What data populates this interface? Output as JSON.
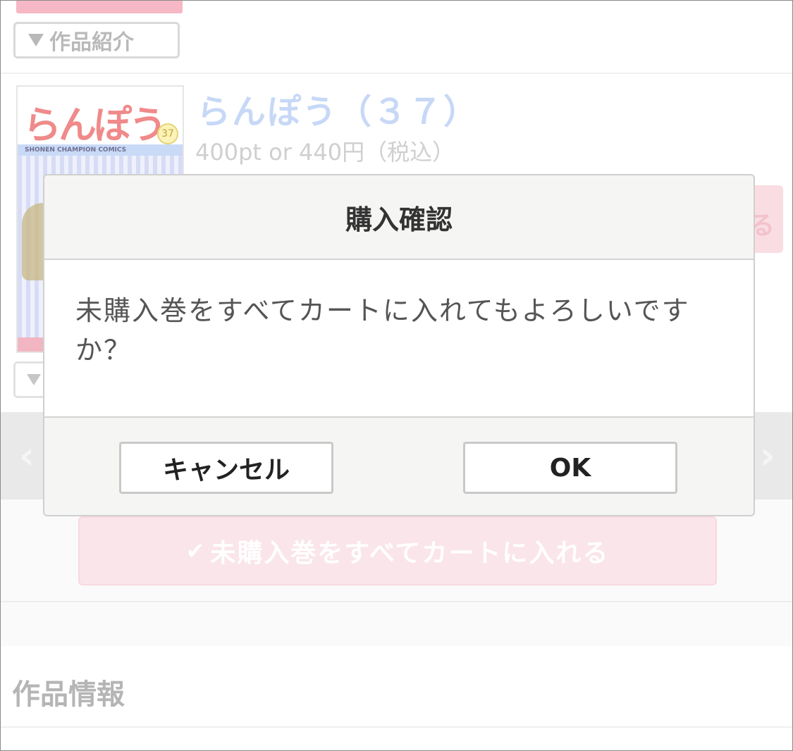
{
  "background": {
    "intro_label": "作品紹介",
    "volume_title": "らんぽう（３７）",
    "volume_price": "400pt or 440円（税込）",
    "cover": {
      "title": "らんぽう",
      "volume_badge": "37",
      "band_text": "SHONEN CHAMPION COMICS"
    },
    "cart_partial": "る",
    "pager": {
      "prev": "‹",
      "next": "›"
    },
    "bulk_button": {
      "check": "✔",
      "label": "未購入巻をすべてカートに入れる"
    },
    "info_heading": "作品情報"
  },
  "dialog": {
    "title": "購入確認",
    "message": "未購入巻をすべてカートに入れてもよろしいですか？",
    "cancel_label": "キャンセル",
    "ok_label": "OK"
  }
}
